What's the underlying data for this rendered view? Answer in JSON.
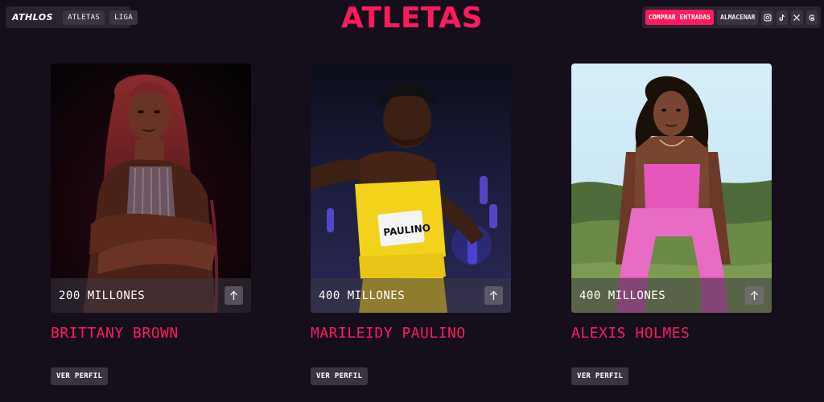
{
  "header": {
    "logo": "ATHLOS",
    "nav": [
      {
        "label": "ATLETAS"
      },
      {
        "label": "LIGA"
      }
    ],
    "cta_label": "COMPRAR ENTRADAS",
    "store_label": "ALMACENAR",
    "social_icons": [
      "instagram-icon",
      "tiktok-icon",
      "x-icon",
      "threads-icon"
    ]
  },
  "page": {
    "title": "ATLETAS"
  },
  "athletes": [
    {
      "name": "BRITTANY BROWN",
      "amount": "200 MILLONES",
      "profile_label": "VER PERFIL"
    },
    {
      "name": "MARILEIDY PAULINO",
      "amount": "400 MILLONES",
      "profile_label": "VER PERFIL",
      "bib_text": "PAULINO"
    },
    {
      "name": "ALEXIS HOLMES",
      "amount": "400 MILLONES",
      "profile_label": "VER PERFIL"
    }
  ],
  "colors": {
    "background": "#150f1b",
    "accent": "#ff1a5e",
    "panel": "#2a2430"
  }
}
